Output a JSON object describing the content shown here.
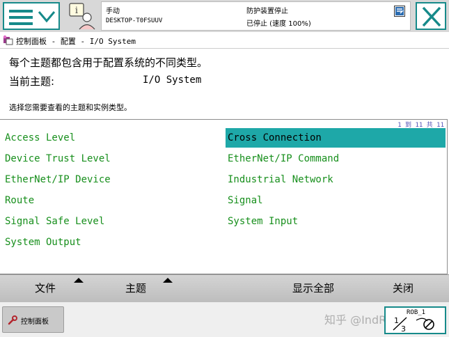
{
  "status": {
    "mode": "手动",
    "host": "DESKTOP-T0FSUUV",
    "guard": "防护装置停止",
    "speed": "已停止 (速度 100%)"
  },
  "breadcrumb": "控制面板 - 配置 - I/O System",
  "info": {
    "description": "每个主题都包含用于配置系统的不同类型。",
    "current_topic_label": "当前主题:",
    "current_topic_value": "I/O System",
    "instruction": "选择您需要查看的主题和实例类型。"
  },
  "list": {
    "pager": "1 到 11 共 11",
    "left": [
      "Access Level",
      "Device Trust Level",
      "EtherNet/IP Device",
      "Route",
      "Signal Safe Level",
      "System Output"
    ],
    "right": [
      "Cross Connection",
      "EtherNet/IP Command",
      "Industrial Network",
      "Signal",
      "System Input"
    ],
    "selected": "Cross Connection"
  },
  "commands": {
    "file": "文件",
    "topic": "主题",
    "show_all": "显示全部",
    "close": "关闭"
  },
  "taskbar": {
    "control_panel": "控制面板",
    "watermark": "知乎 @IndRobSim",
    "rob": "ROB_1",
    "speed_fraction": "1/3"
  },
  "colors": {
    "accent": "#168a8a",
    "selected": "#1ea8a8",
    "topic_text": "#178f1c"
  },
  "icons": [
    "hamburger-menu-icon",
    "chevron-down-icon",
    "operator-info-icon",
    "status-event-icon",
    "close-x-icon",
    "control-panel-icon",
    "wrench-icon",
    "speed-fraction-icon"
  ]
}
